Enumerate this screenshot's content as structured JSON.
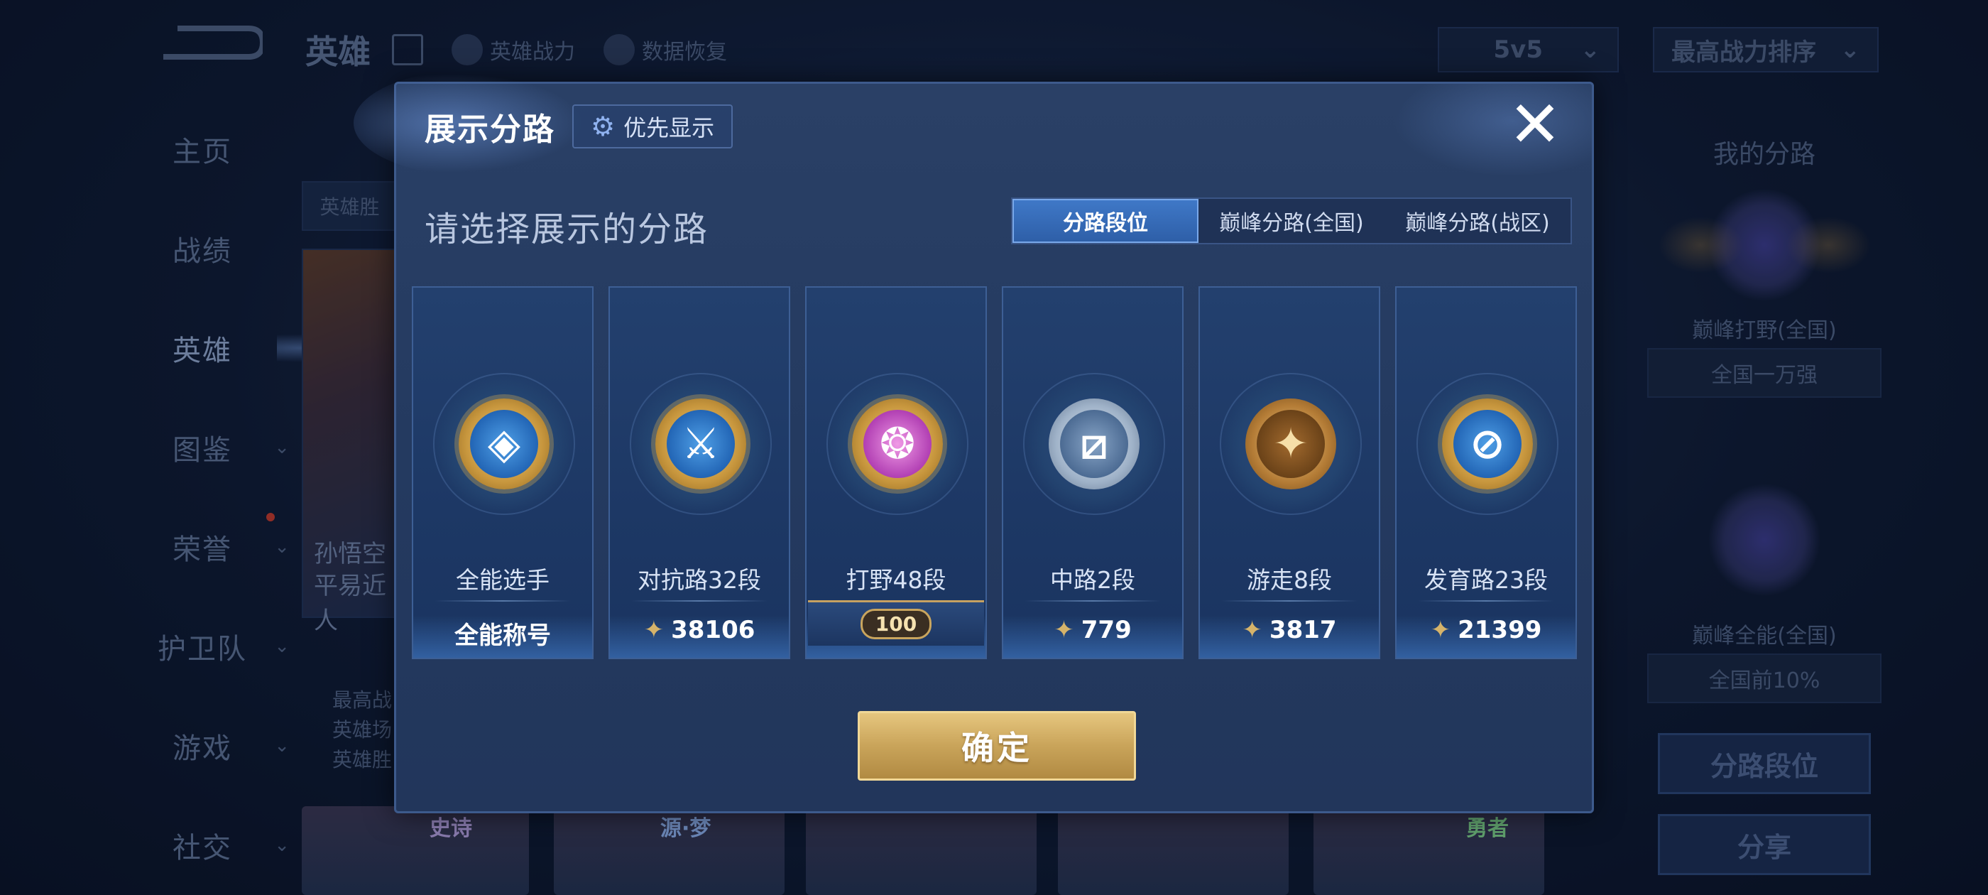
{
  "sidebar": {
    "items": [
      {
        "label": "主页",
        "chevron": false,
        "active": false
      },
      {
        "label": "战绩",
        "chevron": false,
        "active": false
      },
      {
        "label": "英雄",
        "chevron": false,
        "active": true
      },
      {
        "label": "图鉴",
        "chevron": true,
        "active": false
      },
      {
        "label": "荣誉",
        "chevron": true,
        "active": false
      },
      {
        "label": "护卫队",
        "chevron": true,
        "active": false
      },
      {
        "label": "游戏",
        "chevron": true,
        "active": false
      },
      {
        "label": "社交",
        "chevron": true,
        "active": false
      }
    ],
    "chevron_glyph": "⌄"
  },
  "topbar": {
    "title": "英雄",
    "links": [
      "英雄战力",
      "数据恢复"
    ],
    "mode_select": "5v5",
    "sort_select": "最高战力排序",
    "select_chevron": "⌄"
  },
  "background": {
    "hero_name_line1": "孙悟空",
    "hero_name_line2": "平易近人",
    "stats_lines": [
      "最高战",
      "英雄场",
      "英雄胜"
    ],
    "hero_tab_label": "英雄胜",
    "strip_labels": [
      "史诗",
      "源·梦",
      "",
      "",
      "勇者"
    ]
  },
  "right_panel": {
    "title": "我的分路",
    "primary_label": "巅峰打野(全国)",
    "primary_rank": "全国一万强",
    "secondary_label": "巅峰全能(全国)",
    "secondary_rank": "全国前10%",
    "buttons": [
      "分路段位",
      "分享"
    ]
  },
  "modal": {
    "title": "展示分路",
    "priority_button": "优先显示",
    "gear_glyph": "⚙",
    "close_glyph": "✕",
    "section_title": "请选择展示的分路",
    "tabs": [
      {
        "label": "分路段位",
        "active": true
      },
      {
        "label": "巅峰分路(全国)",
        "active": false
      },
      {
        "label": "巅峰分路(战区)",
        "active": false
      }
    ],
    "cards": [
      {
        "name": "全能选手",
        "value": "全能称号",
        "points_icon": false,
        "badge": "gold",
        "icon": "all-round-icon",
        "glyph": "◈"
      },
      {
        "name": "对抗路32段",
        "value": "38106",
        "points_icon": true,
        "badge": "gold",
        "icon": "clash-lane-icon",
        "glyph": "⚔"
      },
      {
        "name": "打野48段",
        "value": "100",
        "points_icon": false,
        "badge": "pink",
        "icon": "jungle-icon",
        "glyph": "❂",
        "rank_plate": true
      },
      {
        "name": "中路2段",
        "value": "779",
        "points_icon": true,
        "badge": "silver",
        "icon": "mid-lane-icon",
        "glyph": "⧄"
      },
      {
        "name": "游走8段",
        "value": "3817",
        "points_icon": true,
        "badge": "bronze",
        "icon": "roam-icon",
        "glyph": "✦"
      },
      {
        "name": "发育路23段",
        "value": "21399",
        "points_icon": true,
        "badge": "gold",
        "icon": "farm-lane-icon",
        "glyph": "⊘"
      }
    ],
    "points_glyph": "✦",
    "confirm_button": "确定"
  }
}
